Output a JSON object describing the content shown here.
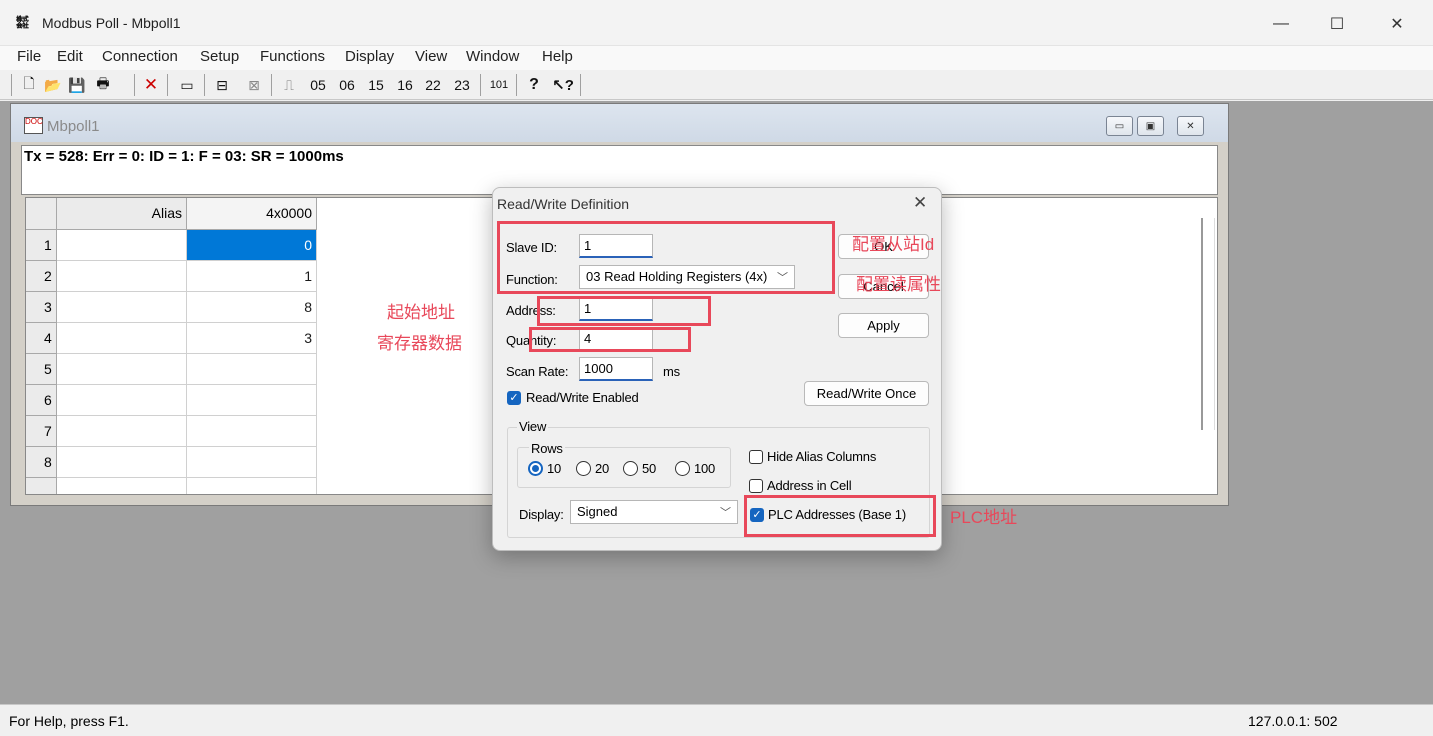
{
  "window": {
    "title": "Modbus Poll - Mbpoll1",
    "min_glyph": "—",
    "max_glyph": "☐",
    "close_glyph": "✕"
  },
  "menu": [
    "File",
    "Edit",
    "Connection",
    "Setup",
    "Functions",
    "Display",
    "View",
    "Window",
    "Help"
  ],
  "toolbar": {
    "codes": [
      "05",
      "06",
      "15",
      "16",
      "22",
      "23"
    ],
    "code_101": "101"
  },
  "child": {
    "title": "Mbpoll1",
    "status": "Tx = 528: Err = 0: ID = 1: F = 03: SR = 1000ms",
    "grid": {
      "col_headers": [
        "Alias",
        "4x0000"
      ],
      "rows": [
        {
          "num": "1",
          "alias": "",
          "value": "0"
        },
        {
          "num": "2",
          "alias": "",
          "value": "1"
        },
        {
          "num": "3",
          "alias": "",
          "value": "8"
        },
        {
          "num": "4",
          "alias": "",
          "value": "3"
        },
        {
          "num": "5",
          "alias": "",
          "value": ""
        },
        {
          "num": "6",
          "alias": "",
          "value": ""
        },
        {
          "num": "7",
          "alias": "",
          "value": ""
        },
        {
          "num": "8",
          "alias": "",
          "value": ""
        }
      ]
    }
  },
  "dialog": {
    "title": "Read/Write Definition",
    "slave_id_label": "Slave ID:",
    "slave_id": "1",
    "function_label": "Function:",
    "function": "03 Read Holding Registers (4x)",
    "address_label": "Address:",
    "address": "1",
    "quantity_label": "Quantity:",
    "quantity": "4",
    "scan_rate_label": "Scan Rate:",
    "scan_rate": "1000",
    "scan_rate_unit": "ms",
    "rw_enabled_label": "Read/Write Enabled",
    "ok": "OK",
    "cancel": "Cancel",
    "apply": "Apply",
    "rw_once": "Read/Write Once",
    "view_label": "View",
    "rows_label": "Rows",
    "rows_options": [
      "10",
      "20",
      "50",
      "100"
    ],
    "rows_selected": "10",
    "hide_alias_label": "Hide Alias Columns",
    "address_in_cell_label": "Address in Cell",
    "plc_addresses_label": "PLC Addresses (Base 1)",
    "display_label": "Display:",
    "display": "Signed"
  },
  "annotations": {
    "slave_id": "配置从站Id",
    "read_attr": "配置读属性",
    "start_addr": "起始地址",
    "register_data": "寄存器数据",
    "plc_addr": "PLC地址"
  },
  "statusbar": {
    "left": "For Help, press F1.",
    "right": "127.0.0.1: 502"
  },
  "colors": {
    "annotation": "#e8485a",
    "selection": "#0078d7",
    "checkbox": "#1565c0"
  }
}
